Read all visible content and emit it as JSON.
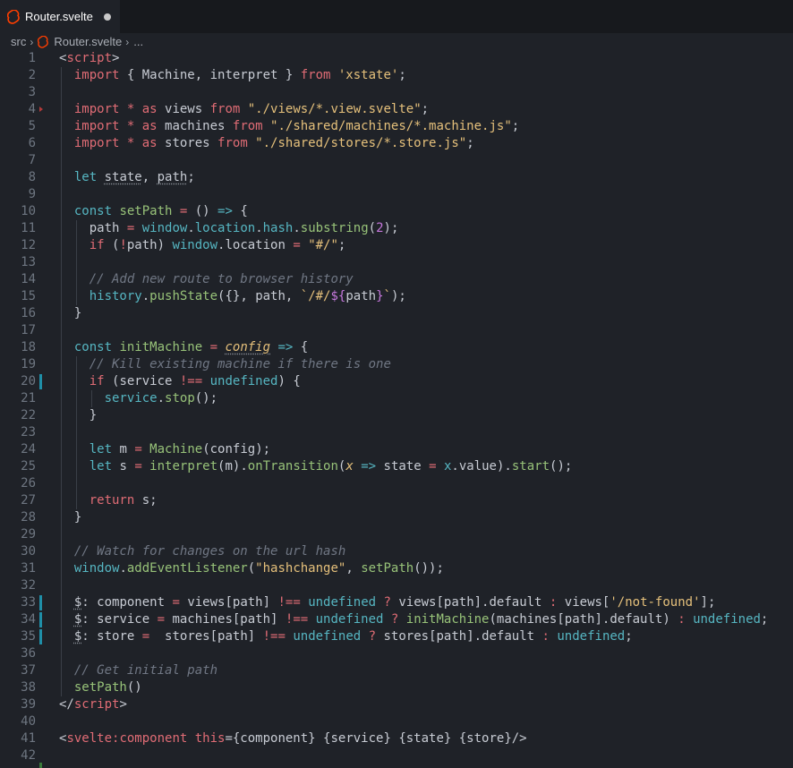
{
  "tab": {
    "filename": "Router.svelte",
    "dirty": true
  },
  "breadcrumb": {
    "folder": "src",
    "file": "Router.svelte",
    "more": "..."
  },
  "editor": {
    "lines": [
      [
        [
          "t-punc",
          "<"
        ],
        [
          "t-tag",
          "script"
        ],
        [
          "t-punc",
          ">"
        ]
      ],
      [
        [
          "",
          "  "
        ],
        [
          "t-kw",
          "import"
        ],
        [
          "t-var",
          " { Machine, interpret } "
        ],
        [
          "t-kw",
          "from"
        ],
        [
          "t-str",
          " 'xstate'"
        ],
        [
          "t-punc",
          ";"
        ]
      ],
      [
        [
          "",
          ""
        ]
      ],
      [
        [
          "",
          "  "
        ],
        [
          "t-kw",
          "import"
        ],
        [
          "t-op",
          " * "
        ],
        [
          "t-kw",
          "as"
        ],
        [
          "t-var",
          " views "
        ],
        [
          "t-kw",
          "from"
        ],
        [
          "t-str",
          " \"./views/*.view.svelte\""
        ],
        [
          "t-punc",
          ";"
        ]
      ],
      [
        [
          "",
          "  "
        ],
        [
          "t-kw",
          "import"
        ],
        [
          "t-op",
          " * "
        ],
        [
          "t-kw",
          "as"
        ],
        [
          "t-var",
          " machines "
        ],
        [
          "t-kw",
          "from"
        ],
        [
          "t-str",
          " \"./shared/machines/*.machine.js\""
        ],
        [
          "t-punc",
          ";"
        ]
      ],
      [
        [
          "",
          "  "
        ],
        [
          "t-kw",
          "import"
        ],
        [
          "t-op",
          " * "
        ],
        [
          "t-kw",
          "as"
        ],
        [
          "t-var",
          " stores "
        ],
        [
          "t-kw",
          "from"
        ],
        [
          "t-str",
          " \"./shared/stores/*.store.js\""
        ],
        [
          "t-punc",
          ";"
        ]
      ],
      [
        [
          "",
          ""
        ]
      ],
      [
        [
          "",
          "  "
        ],
        [
          "t-decl",
          "let"
        ],
        [
          "t-var",
          " "
        ],
        [
          "t-var dotted",
          "state"
        ],
        [
          "t-var",
          ", "
        ],
        [
          "t-var dotted",
          "path"
        ],
        [
          "t-punc",
          ";"
        ]
      ],
      [
        [
          "",
          ""
        ]
      ],
      [
        [
          "",
          "  "
        ],
        [
          "t-decl",
          "const"
        ],
        [
          "t-fn",
          " setPath"
        ],
        [
          "t-op",
          " = "
        ],
        [
          "t-punc",
          "() "
        ],
        [
          "t-decl",
          "=>"
        ],
        [
          "t-punc",
          " {"
        ]
      ],
      [
        [
          "",
          "    "
        ],
        [
          "t-var",
          "path"
        ],
        [
          "t-op",
          " = "
        ],
        [
          "t-win",
          "window"
        ],
        [
          "t-punc",
          "."
        ],
        [
          "t-prop",
          "location"
        ],
        [
          "t-punc",
          "."
        ],
        [
          "t-prop",
          "hash"
        ],
        [
          "t-punc",
          "."
        ],
        [
          "t-fn",
          "substring"
        ],
        [
          "t-punc",
          "("
        ],
        [
          "t-num",
          "2"
        ],
        [
          "t-punc",
          ");"
        ]
      ],
      [
        [
          "",
          "    "
        ],
        [
          "t-kw",
          "if"
        ],
        [
          "t-punc",
          " ("
        ],
        [
          "t-op",
          "!"
        ],
        [
          "t-var",
          "path"
        ],
        [
          "t-punc",
          ") "
        ],
        [
          "t-win",
          "window"
        ],
        [
          "t-punc",
          "."
        ],
        [
          "t-var",
          "location"
        ],
        [
          "t-op",
          " = "
        ],
        [
          "t-str",
          "\"#/\""
        ],
        [
          "t-punc",
          ";"
        ]
      ],
      [
        [
          "",
          ""
        ]
      ],
      [
        [
          "",
          "    "
        ],
        [
          "t-comment",
          "// Add new route to browser history"
        ]
      ],
      [
        [
          "",
          "    "
        ],
        [
          "t-win",
          "history"
        ],
        [
          "t-punc",
          "."
        ],
        [
          "t-fn",
          "pushState"
        ],
        [
          "t-punc",
          "({}, "
        ],
        [
          "t-var",
          "path"
        ],
        [
          "t-punc",
          ", "
        ],
        [
          "t-tmpl",
          "`/#/"
        ],
        [
          "t-interp",
          "${"
        ],
        [
          "t-var",
          "path"
        ],
        [
          "t-interp",
          "}"
        ],
        [
          "t-tmpl",
          "`"
        ],
        [
          "t-punc",
          ");"
        ]
      ],
      [
        [
          "",
          "  "
        ],
        [
          "t-punc",
          "}"
        ]
      ],
      [
        [
          "",
          ""
        ]
      ],
      [
        [
          "",
          "  "
        ],
        [
          "t-decl",
          "const"
        ],
        [
          "t-fn",
          " initMachine"
        ],
        [
          "t-op",
          " = "
        ],
        [
          "t-param dotted",
          "config"
        ],
        [
          "t-decl",
          " =>"
        ],
        [
          "t-punc",
          " {"
        ]
      ],
      [
        [
          "",
          "    "
        ],
        [
          "t-comment",
          "// Kill existing machine if there is one"
        ]
      ],
      [
        [
          "",
          "    "
        ],
        [
          "t-kw",
          "if"
        ],
        [
          "t-punc",
          " ("
        ],
        [
          "t-var",
          "service"
        ],
        [
          "t-op",
          " !== "
        ],
        [
          "t-undef",
          "undefined"
        ],
        [
          "t-punc",
          ") {"
        ]
      ],
      [
        [
          "",
          "      "
        ],
        [
          "t-prop",
          "service"
        ],
        [
          "t-punc",
          "."
        ],
        [
          "t-fn",
          "stop"
        ],
        [
          "t-punc",
          "();"
        ]
      ],
      [
        [
          "",
          "    "
        ],
        [
          "t-punc",
          "}"
        ]
      ],
      [
        [
          "",
          ""
        ]
      ],
      [
        [
          "",
          "    "
        ],
        [
          "t-decl",
          "let"
        ],
        [
          "t-var",
          " m "
        ],
        [
          "t-op",
          "= "
        ],
        [
          "t-fn",
          "Machine"
        ],
        [
          "t-punc",
          "("
        ],
        [
          "t-var",
          "config"
        ],
        [
          "t-punc",
          ");"
        ]
      ],
      [
        [
          "",
          "    "
        ],
        [
          "t-decl",
          "let"
        ],
        [
          "t-var",
          " s "
        ],
        [
          "t-op",
          "= "
        ],
        [
          "t-fn",
          "interpret"
        ],
        [
          "t-punc",
          "("
        ],
        [
          "t-var",
          "m"
        ],
        [
          "t-punc",
          ")."
        ],
        [
          "t-fn",
          "onTransition"
        ],
        [
          "t-punc",
          "("
        ],
        [
          "t-param",
          "x"
        ],
        [
          "t-decl",
          " =>"
        ],
        [
          "t-var",
          " state "
        ],
        [
          "t-op",
          "= "
        ],
        [
          "t-prop",
          "x"
        ],
        [
          "t-punc",
          "."
        ],
        [
          "t-var",
          "value"
        ],
        [
          "t-punc",
          ")."
        ],
        [
          "t-fn",
          "start"
        ],
        [
          "t-punc",
          "();"
        ]
      ],
      [
        [
          "",
          ""
        ]
      ],
      [
        [
          "",
          "    "
        ],
        [
          "t-kw",
          "return"
        ],
        [
          "t-var",
          " s"
        ],
        [
          "t-punc",
          ";"
        ]
      ],
      [
        [
          "",
          "  "
        ],
        [
          "t-punc",
          "}"
        ]
      ],
      [
        [
          "",
          ""
        ]
      ],
      [
        [
          "",
          "  "
        ],
        [
          "t-comment",
          "// Watch for changes on the url hash"
        ]
      ],
      [
        [
          "",
          "  "
        ],
        [
          "t-win",
          "window"
        ],
        [
          "t-punc",
          "."
        ],
        [
          "t-fn",
          "addEventListener"
        ],
        [
          "t-punc",
          "("
        ],
        [
          "t-str",
          "\"hashchange\""
        ],
        [
          "t-punc",
          ", "
        ],
        [
          "t-fn",
          "setPath"
        ],
        [
          "t-punc",
          "());"
        ]
      ],
      [
        [
          "",
          ""
        ]
      ],
      [
        [
          "",
          "  "
        ],
        [
          "t-var dotted",
          "$"
        ],
        [
          "t-punc",
          ":"
        ],
        [
          "t-var",
          " component "
        ],
        [
          "t-op",
          "= "
        ],
        [
          "t-var",
          "views[path] "
        ],
        [
          "t-op",
          "!== "
        ],
        [
          "t-undef",
          "undefined"
        ],
        [
          "t-op",
          " ? "
        ],
        [
          "t-var",
          "views[path].default "
        ],
        [
          "t-op",
          ": "
        ],
        [
          "t-var",
          "views["
        ],
        [
          "t-str",
          "'/not-found'"
        ],
        [
          "t-var",
          "];"
        ]
      ],
      [
        [
          "",
          "  "
        ],
        [
          "t-var dotted",
          "$"
        ],
        [
          "t-punc",
          ":"
        ],
        [
          "t-var",
          " service "
        ],
        [
          "t-op",
          "= "
        ],
        [
          "t-var",
          "machines[path] "
        ],
        [
          "t-op",
          "!== "
        ],
        [
          "t-undef",
          "undefined"
        ],
        [
          "t-op",
          " ? "
        ],
        [
          "t-fn",
          "initMachine"
        ],
        [
          "t-var",
          "(machines[path].default) "
        ],
        [
          "t-op",
          ": "
        ],
        [
          "t-undef",
          "undefined"
        ],
        [
          "t-punc",
          ";"
        ]
      ],
      [
        [
          "",
          "  "
        ],
        [
          "t-var dotted",
          "$"
        ],
        [
          "t-punc",
          ":"
        ],
        [
          "t-var",
          " store "
        ],
        [
          "t-op",
          "= "
        ],
        [
          "t-var",
          " stores[path] "
        ],
        [
          "t-op",
          "!== "
        ],
        [
          "t-undef",
          "undefined"
        ],
        [
          "t-op",
          " ? "
        ],
        [
          "t-var",
          "stores[path].default "
        ],
        [
          "t-op",
          ": "
        ],
        [
          "t-undef",
          "undefined"
        ],
        [
          "t-punc",
          ";"
        ]
      ],
      [
        [
          "",
          ""
        ]
      ],
      [
        [
          "",
          "  "
        ],
        [
          "t-comment",
          "// Get initial path"
        ]
      ],
      [
        [
          "",
          "  "
        ],
        [
          "t-fn",
          "setPath"
        ],
        [
          "t-punc",
          "()"
        ]
      ],
      [
        [
          "t-punc",
          "</"
        ],
        [
          "t-tag",
          "script"
        ],
        [
          "t-punc",
          ">"
        ]
      ],
      [
        [
          "",
          ""
        ]
      ],
      [
        [
          "t-punc",
          "<"
        ],
        [
          "t-tag",
          "svelte:component"
        ],
        [
          "t-kw",
          " this"
        ],
        [
          "t-punc",
          "={component} {service} {state} {store}/>"
        ]
      ],
      [
        [
          "",
          ""
        ]
      ]
    ],
    "modified_lines": [
      20,
      33,
      34,
      35
    ],
    "fold_marker_line": 4,
    "guide_levels": {
      "2": 1,
      "4": 1,
      "5": 1,
      "6": 1,
      "8": 1,
      "10": 1,
      "11": 2,
      "12": 2,
      "13": 2,
      "14": 2,
      "15": 2,
      "16": 1,
      "18": 1,
      "19": 2,
      "20": 2,
      "21": 3,
      "22": 2,
      "23": 2,
      "24": 2,
      "25": 2,
      "26": 2,
      "27": 2,
      "28": 1,
      "30": 1,
      "31": 1,
      "33": 1,
      "34": 1,
      "35": 1,
      "37": 1,
      "38": 1,
      "3": 1,
      "7": 1,
      "9": 1,
      "17": 1,
      "29": 1,
      "32": 1,
      "36": 1
    }
  }
}
